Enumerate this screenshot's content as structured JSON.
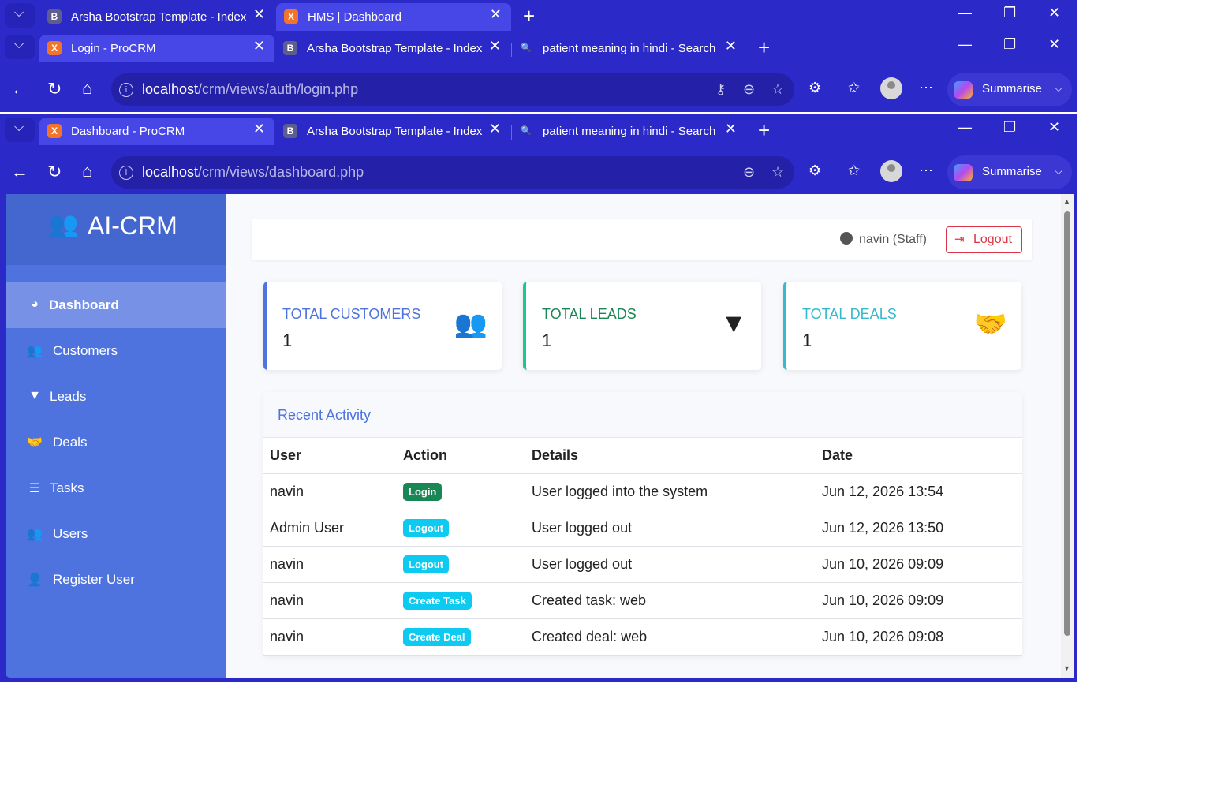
{
  "browser1": {
    "tabs": [
      {
        "icon": "B",
        "title": "Arsha Bootstrap Template - Index",
        "close": "✕"
      },
      {
        "icon": "X",
        "title": "HMS | Dashboard",
        "close": "✕"
      }
    ]
  },
  "browser2": {
    "tabs": [
      {
        "icon": "X",
        "title": "Login - ProCRM",
        "close": "✕"
      },
      {
        "icon": "B",
        "title": "Arsha Bootstrap Template - Index",
        "close": "✕"
      },
      {
        "icon": "🔍",
        "title": "patient meaning in hindi - Search",
        "close": "✕"
      }
    ],
    "url_host": "localhost",
    "url_path": "/crm/views/auth/login.php"
  },
  "browser3": {
    "tabs": [
      {
        "icon": "X",
        "title": "Dashboard - ProCRM",
        "close": "✕"
      },
      {
        "icon": "B",
        "title": "Arsha Bootstrap Template - Index",
        "close": "✕"
      },
      {
        "icon": "🔍",
        "title": "patient meaning in hindi - Search",
        "close": "✕"
      }
    ],
    "url_host": "localhost",
    "url_path": "/crm/views/dashboard.php"
  },
  "toolbar": {
    "summarise": "Summarise"
  },
  "app": {
    "brand": "AI-CRM",
    "menu": [
      {
        "icon": "speedometer-icon",
        "glyph": "◕",
        "label": "Dashboard"
      },
      {
        "icon": "users-icon",
        "glyph": "👥",
        "label": "Customers"
      },
      {
        "icon": "funnel-icon",
        "glyph": "▼",
        "label": "Leads"
      },
      {
        "icon": "handshake-icon",
        "glyph": "🤝",
        "label": "Deals"
      },
      {
        "icon": "tasks-icon",
        "glyph": "☰",
        "label": "Tasks"
      },
      {
        "icon": "users-cog-icon",
        "glyph": "👥",
        "label": "Users"
      },
      {
        "icon": "user-plus-icon",
        "glyph": "👤",
        "label": "Register User"
      }
    ],
    "user_label": "navin (Staff)",
    "logout_label": "Logout",
    "cards": [
      {
        "label": "TOTAL CUSTOMERS",
        "value": "1",
        "color": "#4e73df",
        "icon": "users-icon"
      },
      {
        "label": "TOTAL LEADS",
        "value": "1",
        "color": "#1cc88a",
        "icon": "funnel-icon"
      },
      {
        "label": "TOTAL DEALS",
        "value": "1",
        "color": "#36b9cc",
        "icon": "handshake-icon"
      }
    ],
    "recent_activity": {
      "title": "Recent Activity",
      "headers": [
        "User",
        "Action",
        "Details",
        "Date"
      ],
      "rows": [
        {
          "user": "navin",
          "action": "Login",
          "action_color": "#198754",
          "details": "User logged into the system",
          "date": "Jun 12, 2026 13:54"
        },
        {
          "user": "Admin User",
          "action": "Logout",
          "action_color": "#0dcaf0",
          "details": "User logged out",
          "date": "Jun 12, 2026 13:50"
        },
        {
          "user": "navin",
          "action": "Logout",
          "action_color": "#0dcaf0",
          "details": "User logged out",
          "date": "Jun 10, 2026 09:09"
        },
        {
          "user": "navin",
          "action": "Create Task",
          "action_color": "#0dcaf0",
          "details": "Created task: web",
          "date": "Jun 10, 2026 09:09"
        },
        {
          "user": "navin",
          "action": "Create Deal",
          "action_color": "#0dcaf0",
          "details": "Created deal: web",
          "date": "Jun 10, 2026 09:08"
        }
      ]
    }
  }
}
